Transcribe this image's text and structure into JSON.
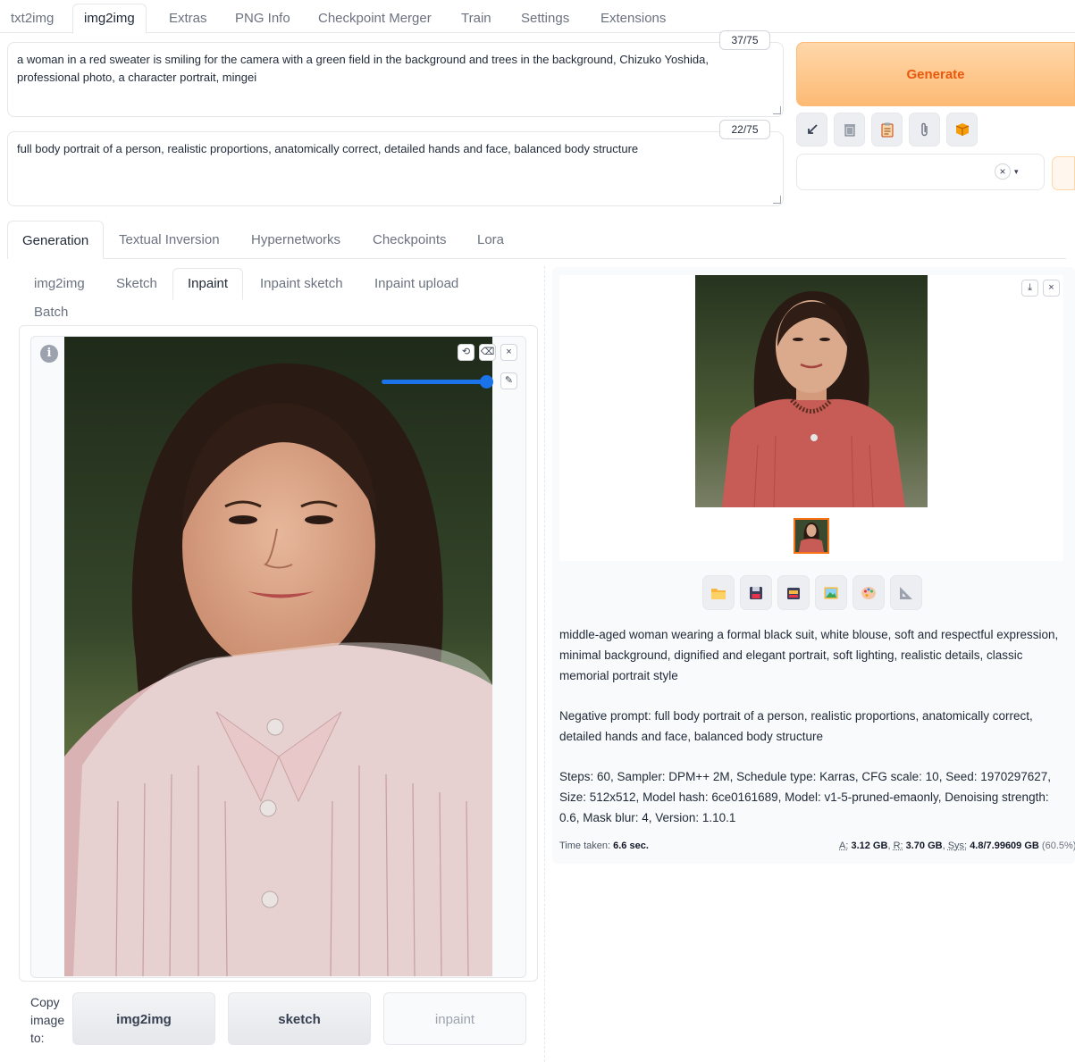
{
  "top_tabs": [
    "txt2img",
    "img2img",
    "Extras",
    "PNG Info",
    "Checkpoint Merger",
    "Train",
    "Settings",
    "Extensions"
  ],
  "prompt": {
    "text": "a woman in a red sweater is smiling for the camera with a green field in the background and trees in the background, Chizuko Yoshida, professional photo, a character portrait, mingei",
    "token_count": "37/75"
  },
  "negative_prompt": {
    "text": "full body portrait of a person, realistic proportions, anatomically correct, detailed hands and face, balanced body structure",
    "token_count": "22/75"
  },
  "generate": {
    "label": "Generate"
  },
  "tool_buttons": [
    "arrow-icon",
    "trash-icon",
    "clipboard-icon",
    "paperclip-icon",
    "box-icon"
  ],
  "style_select": {
    "clear": "×",
    "caret": "▾"
  },
  "extra_tabs": [
    "Generation",
    "Textual Inversion",
    "Hypernetworks",
    "Checkpoints",
    "Lora"
  ],
  "mode_tabs": [
    "img2img",
    "Sketch",
    "Inpaint",
    "Inpaint sketch",
    "Inpaint upload",
    "Batch"
  ],
  "canvas": {
    "info": "i",
    "undo": "⟲",
    "eraser": "⌫",
    "close": "×",
    "brush": "✎",
    "brush_size": 0.95
  },
  "copy_to": {
    "label": "Copy image to:",
    "buttons": [
      "img2img",
      "sketch",
      "inpaint"
    ]
  },
  "result": {
    "download": "⤓",
    "close": "×",
    "actions": [
      "folder-icon",
      "save-icon",
      "zip-icon",
      "image-icon",
      "palette-icon",
      "ruler-icon"
    ],
    "positive": "middle-aged woman wearing a formal black suit, white blouse, soft and respectful expression, minimal background, dignified and elegant portrait, soft lighting, realistic details, classic memorial portrait style",
    "negative": "Negative prompt: full body portrait of a person, realistic proportions, anatomically correct, detailed hands and face, balanced body structure",
    "params": "Steps: 60, Sampler: DPM++ 2M, Schedule type: Karras, CFG scale: 10, Seed: 1970297627, Size: 512x512, Model hash: 6ce0161689, Model: v1-5-pruned-emaonly, Denoising strength: 0.6, Mask blur: 4, Version: 1.10.1",
    "time_label": "Time taken:",
    "time_value": "6.6 sec.",
    "vram": {
      "a_label": "A:",
      "a_value": "3.12 GB",
      "r_label": "R:",
      "r_value": "3.70 GB",
      "sys_label": "Sys:",
      "sys_value": "4.8/7.99609 GB",
      "sys_pct": "(60.5%)"
    }
  },
  "colors": {
    "accent_orange": "#f97316",
    "generate_text": "#ea580c",
    "slider_blue": "#1a73e8"
  }
}
